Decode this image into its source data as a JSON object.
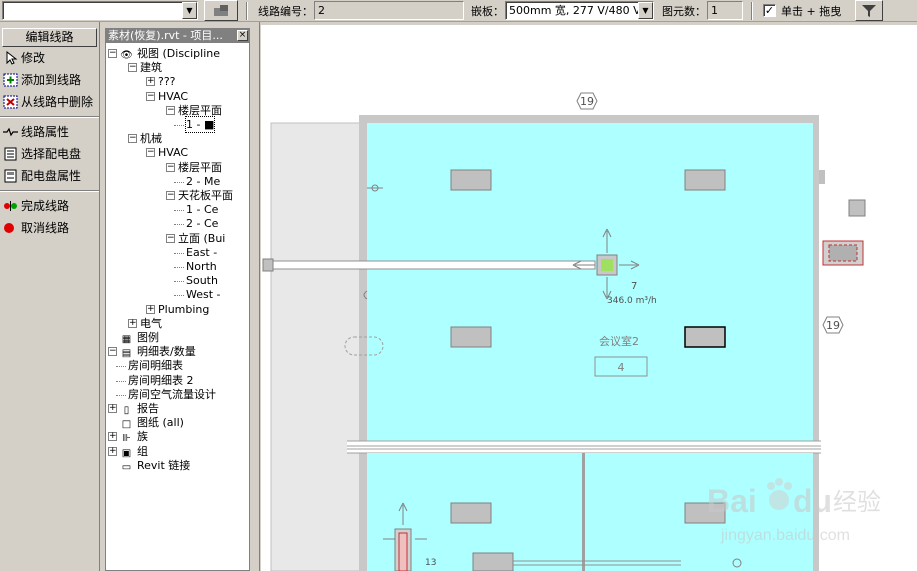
{
  "options_bar": {
    "type_selector_value": "",
    "circuit_number_label": "线路编号：",
    "circuit_number_value": "2",
    "panel_label": "嵌板：",
    "panel_value": "500mm 宽, 277 V/480 V,",
    "element_count_label": "图元数：",
    "element_count_value": "1",
    "click_drag_label": "单击 + 拖曳",
    "click_drag_checked": true
  },
  "design_bar": {
    "header": "编辑线路",
    "buttons": [
      {
        "label": "修改",
        "icon": "pointer-icon"
      },
      {
        "label": "添加到线路",
        "icon": "add-to-circuit-icon"
      },
      {
        "label": "从线路中删除",
        "icon": "remove-from-circuit-icon"
      },
      {
        "label": "线路属性",
        "icon": "circuit-properties-icon"
      },
      {
        "label": "选择配电盘",
        "icon": "select-panel-icon"
      },
      {
        "label": "配电盘属性",
        "icon": "panel-properties-icon"
      },
      {
        "label": "完成线路",
        "icon": "finish-circuit-icon"
      },
      {
        "label": "取消线路",
        "icon": "cancel-circuit-icon"
      }
    ]
  },
  "browser": {
    "title": "素材(恢复).rvt - 项目...",
    "close": "×",
    "nodes": [
      {
        "label": "视图 (Discipline",
        "level": 0,
        "exp": "-",
        "icon": "eye-icon"
      },
      {
        "label": "建筑",
        "level": 1,
        "exp": "-"
      },
      {
        "label": "???",
        "level": 2,
        "exp": "+"
      },
      {
        "label": "HVAC",
        "level": 2,
        "exp": "-"
      },
      {
        "label": "楼层平面",
        "level": 3,
        "exp": "-"
      },
      {
        "label": "1 - ■",
        "level": 4,
        "exp": "",
        "selected": true
      },
      {
        "label": "机械",
        "level": 1,
        "exp": "-"
      },
      {
        "label": "HVAC",
        "level": 2,
        "exp": "-"
      },
      {
        "label": "楼层平面",
        "level": 3,
        "exp": "-"
      },
      {
        "label": "2 - Me",
        "level": 4,
        "exp": ""
      },
      {
        "label": "天花板平面",
        "level": 3,
        "exp": "-"
      },
      {
        "label": "1 - Ce",
        "level": 4,
        "exp": ""
      },
      {
        "label": "2 - Ce",
        "level": 4,
        "exp": ""
      },
      {
        "label": "立面 (Bui",
        "level": 3,
        "exp": "-"
      },
      {
        "label": "East -",
        "level": 4,
        "exp": ""
      },
      {
        "label": "North",
        "level": 4,
        "exp": ""
      },
      {
        "label": "South",
        "level": 4,
        "exp": ""
      },
      {
        "label": "West -",
        "level": 4,
        "exp": ""
      },
      {
        "label": "Plumbing",
        "level": 2,
        "exp": "+"
      },
      {
        "label": "电气",
        "level": 1,
        "exp": "+"
      },
      {
        "label": "图例",
        "level": 0,
        "exp": "",
        "icon": "legend-icon"
      },
      {
        "label": "明细表/数量",
        "level": 0,
        "exp": "-",
        "icon": "schedule-icon"
      },
      {
        "label": "房间明细表",
        "level": 1,
        "exp": ""
      },
      {
        "label": "房间明细表 2",
        "level": 1,
        "exp": ""
      },
      {
        "label": "房间空气流量设计",
        "level": 1,
        "exp": ""
      },
      {
        "label": "报告",
        "level": 0,
        "exp": "+",
        "icon": "report-icon"
      },
      {
        "label": "图纸 (all)",
        "level": 0,
        "exp": "",
        "icon": "sheet-icon"
      },
      {
        "label": "族",
        "level": 0,
        "exp": "+",
        "icon": "family-icon"
      },
      {
        "label": "组",
        "level": 0,
        "exp": "+",
        "icon": "group-icon"
      },
      {
        "label": "Revit 链接",
        "level": 0,
        "exp": "",
        "icon": "link-icon"
      }
    ]
  },
  "drawing": {
    "grid_tag_top": "19",
    "grid_tag_right": "19",
    "room_name": "会议室2",
    "room_number": "4",
    "diffuser_tag": "7",
    "diffuser_flow": "346.0 m³/h",
    "second_tag": "13",
    "colors": {
      "room_fill": "#aeffff",
      "wall": "#c0c0c0",
      "fixture": "#c0c0c0",
      "selected_fixture": "#a0e060"
    }
  },
  "watermark": {
    "brand": "Bai",
    "brand2": "du",
    "brand_cn": "经验",
    "url": "jingyan.baidu.com"
  }
}
